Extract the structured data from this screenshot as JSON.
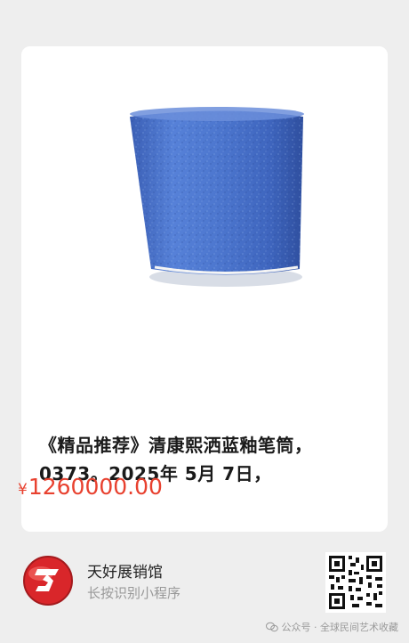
{
  "product": {
    "image_name": "blue-glazed-brush-pot",
    "title": "《精品推荐》清康熙洒蓝釉笔筒，0373。2025年 5月 7日，",
    "currency_symbol": "¥",
    "price": "1260000.00"
  },
  "mini_program": {
    "shop_name": "天好展销馆",
    "hint": "长按识别小程序",
    "logo_icon": "shop-logo-icon",
    "qr_icon": "qr-code-icon"
  },
  "watermark": {
    "text": "公众号 · 全球民间艺术收藏"
  },
  "colors": {
    "price": "#e8412f",
    "glaze": "#4b73c9",
    "logo": "#d9262a"
  }
}
